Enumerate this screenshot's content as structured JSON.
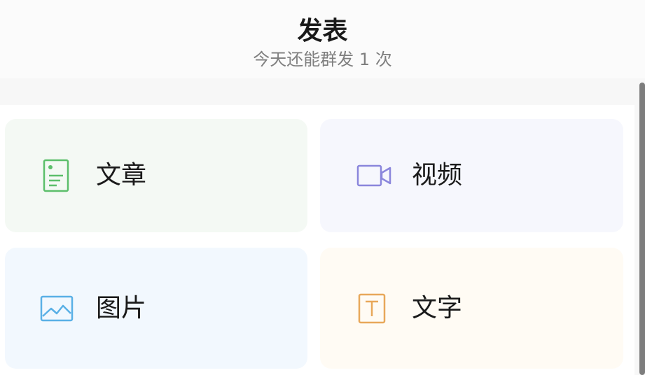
{
  "header": {
    "title": "发表",
    "subtitle": "今天还能群发 1 次"
  },
  "options": [
    {
      "label": "文章",
      "icon": "article-icon",
      "color": "#5cbf6b"
    },
    {
      "label": "视频",
      "icon": "video-icon",
      "color": "#8a86dc"
    },
    {
      "label": "图片",
      "icon": "image-icon",
      "color": "#5ab0e6"
    },
    {
      "label": "文字",
      "icon": "text-icon",
      "color": "#e8a85a"
    }
  ]
}
